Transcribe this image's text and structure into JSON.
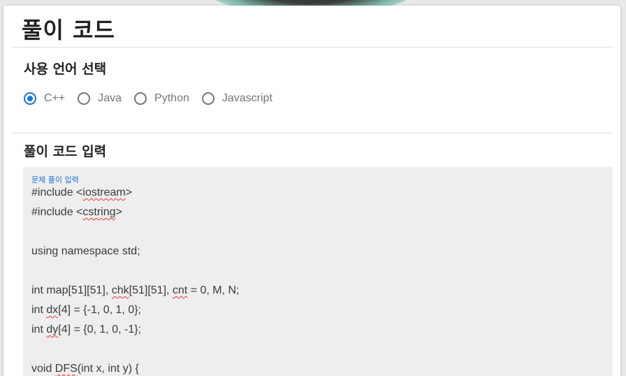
{
  "page": {
    "title": "풀이 코드"
  },
  "language_section": {
    "title": "사용 언어 선택",
    "options": [
      {
        "label": "C++",
        "selected": true
      },
      {
        "label": "Java",
        "selected": false
      },
      {
        "label": "Python",
        "selected": false
      },
      {
        "label": "Javascript",
        "selected": false
      }
    ]
  },
  "code_section": {
    "title": "풀이 코드 입력",
    "field_label": "문제 풀이 입력",
    "lines": {
      "l1": {
        "a": "#include <",
        "b": "iostream",
        "c": ">"
      },
      "l2": {
        "a": "#include <",
        "b": "cstring",
        "c": ">"
      },
      "l3": "",
      "l4": "using namespace std;",
      "l5": "",
      "l6": {
        "a": "int map[51][51], ",
        "b": "chk",
        "c": "[51][51], ",
        "d": "cnt",
        "e": " = 0, M, N;"
      },
      "l7": {
        "a": "int ",
        "b": "dx",
        "c": "[4] = {-1, 0, 1, 0};"
      },
      "l8": {
        "a": "int ",
        "b": "dy",
        "c": "[4] = {0, 1, 0, -1};"
      },
      "l9": "",
      "l10": {
        "a": "void ",
        "b": "DFS",
        "c": "(int x, int y) {"
      }
    }
  },
  "colors": {
    "accent": "#1976d2",
    "radio_unselected": "#757575",
    "field_background": "#eeeeee",
    "spellcheck_underline": "#e53935"
  }
}
